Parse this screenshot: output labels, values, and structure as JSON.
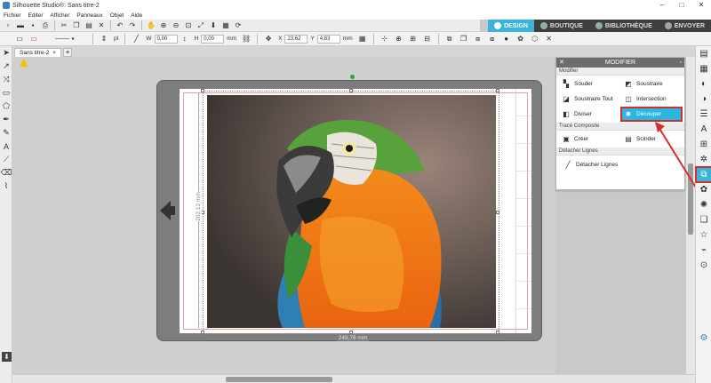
{
  "window": {
    "title": "Silhouette Studio®: Sans titre-2",
    "controls": [
      "–",
      "□",
      "✕"
    ]
  },
  "menu": [
    "Fichier",
    "Editer",
    "Afficher",
    "Panneaux",
    "Objet",
    "Aide"
  ],
  "top_tabs": [
    {
      "label": "DESIGN",
      "active": true
    },
    {
      "label": "BOUTIQUE",
      "active": false
    },
    {
      "label": "BIBLIOTHÈQUE",
      "active": false
    },
    {
      "label": "ENVOYER",
      "active": false
    }
  ],
  "toolbar2": {
    "stroke_unit": "pt",
    "w_label": "W",
    "w_value": "0,00",
    "h_label": "H",
    "h_value": "0,00",
    "unit1": "mm",
    "x_label": "X",
    "x_value": "23,62",
    "y_label": "Y",
    "y_value": "4,83",
    "unit2": "mm"
  },
  "document": {
    "tab_label": "Sans titre-2",
    "add_label": "+"
  },
  "canvas": {
    "width_dim": "249,76 mm",
    "height_dim": "202,12 mm"
  },
  "panel": {
    "title": "MODIFIER",
    "sections": {
      "modifier": {
        "title": "Modifier",
        "buttons": [
          {
            "label": "Souder",
            "icon": "weld-icon"
          },
          {
            "label": "Soustraire",
            "icon": "subtract-icon"
          },
          {
            "label": "Soustraire Tout",
            "icon": "subtract-all-icon"
          },
          {
            "label": "Intersection",
            "icon": "intersect-icon"
          },
          {
            "label": "Diviser",
            "icon": "divide-icon"
          },
          {
            "label": "Découper",
            "icon": "crop-icon",
            "active": true
          }
        ]
      },
      "trace": {
        "title": "Tracé Composite",
        "buttons": [
          {
            "label": "Créer",
            "icon": "make-compound-icon"
          },
          {
            "label": "Scinder",
            "icon": "release-compound-icon"
          }
        ]
      },
      "detach": {
        "title": "Détacher Lignes",
        "button": {
          "label": "Détacher Lignes",
          "icon": "detach-lines-icon"
        }
      }
    }
  },
  "colors": {
    "accent": "#3ab4d9",
    "highlight_border": "#d62c2c",
    "mat": "#7d7d7d"
  }
}
